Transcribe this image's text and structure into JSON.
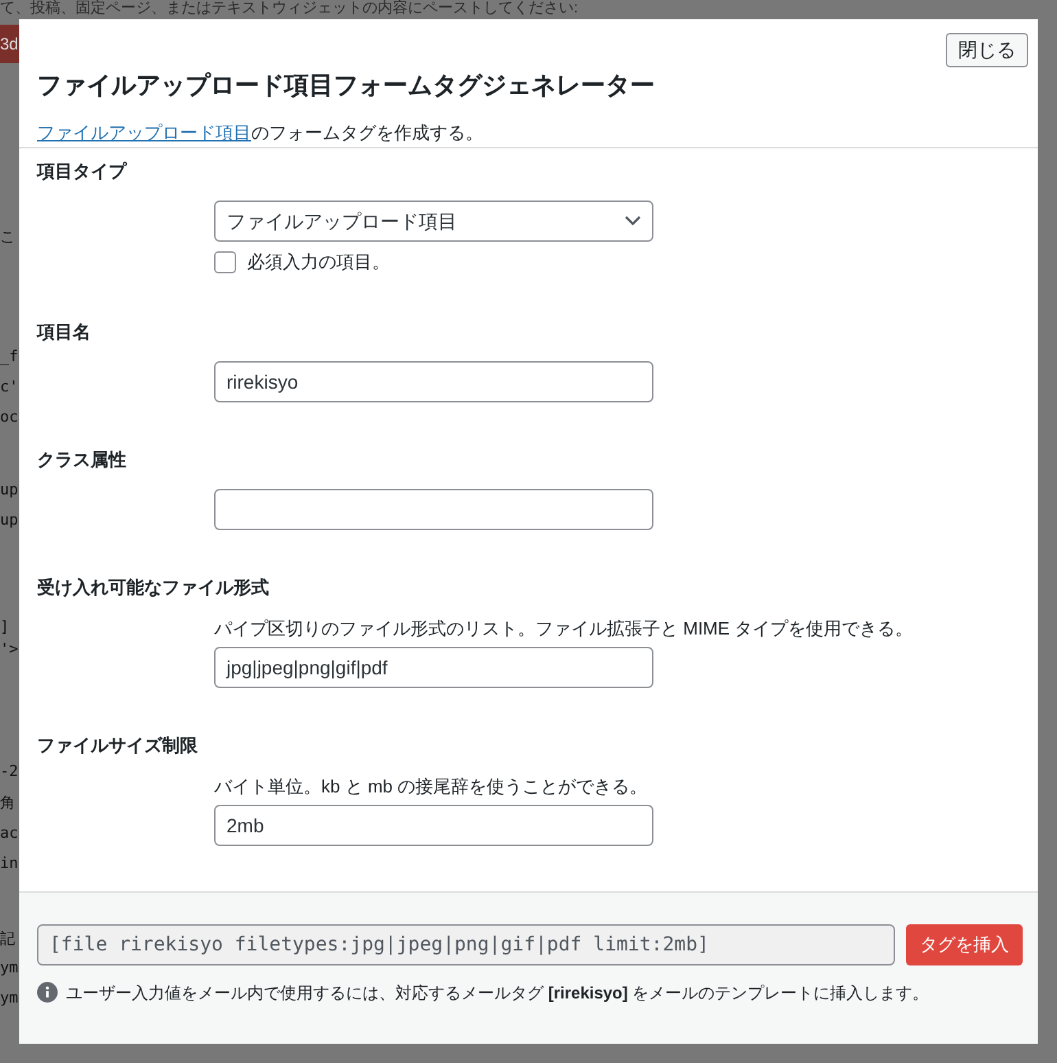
{
  "background": {
    "notice": "て、投稿、固定ページ、またはテキストウィジェットの内容にペーストしてください:",
    "badge": "3d",
    "fragments": [
      "こ",
      "_f",
      "c'",
      "oc",
      "up",
      "up",
      "]",
      "'>",
      "-2",
      "角",
      "ac",
      "in",
      "記",
      "ym",
      "ym"
    ]
  },
  "modal": {
    "title": "ファイルアップロード項目フォームタグジェネレーター",
    "close_button": "閉じる",
    "intro": {
      "link": "ファイルアップロード項目",
      "text": "のフォームタグを作成する。"
    },
    "fields": [
      {
        "kind": "select",
        "label": "項目タイプ",
        "value": "ファイルアップロード項目",
        "checkbox": {
          "label": "必須入力の項目。",
          "checked": false
        }
      },
      {
        "kind": "text",
        "label": "項目名",
        "value": "rirekisyo"
      },
      {
        "kind": "text",
        "label": "クラス属性"
      },
      {
        "kind": "text",
        "label": "受け入れ可能なファイル形式",
        "description": "パイプ区切りのファイル形式のリスト。ファイル拡張子と MIME タイプを使用できる。",
        "value": "jpg|jpeg|png|gif|pdf"
      },
      {
        "kind": "text",
        "label": "ファイルサイズ制限",
        "description": "バイト単位。kb と mb の接尾辞を使うことができる。",
        "value": "2mb"
      }
    ],
    "footer": {
      "tag": "[file rirekisyo filetypes:jpg|jpeg|png|gif|pdf limit:2mb]",
      "insert_button": "タグを挿入",
      "note": "ユーザー入力値をメール内で使用するには、対応するメールタグ **[rirekisyo]** をメールのテンプレートに挿入します。"
    }
  }
}
